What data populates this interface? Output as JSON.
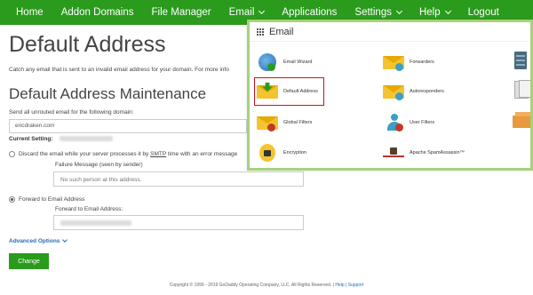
{
  "nav": {
    "items": [
      {
        "label": "Home",
        "dropdown": false
      },
      {
        "label": "Addon Domains",
        "dropdown": false
      },
      {
        "label": "File Manager",
        "dropdown": false
      },
      {
        "label": "Email",
        "dropdown": true
      },
      {
        "label": "Applications",
        "dropdown": false
      },
      {
        "label": "Settings",
        "dropdown": true
      },
      {
        "label": "Help",
        "dropdown": true
      },
      {
        "label": "Logout",
        "dropdown": false
      }
    ],
    "color": "#2b9b1d"
  },
  "page": {
    "title": "Default Address",
    "intro": "Catch any email that is sent to an invalid email address for your domain. For more info",
    "section_title": "Default Address Maintenance",
    "send_label": "Send all unrouted email for the following domain:",
    "domain_value": "ericdraken.com",
    "current_setting_label": "Current Setting:",
    "option_discard": {
      "label_before": "Discard the email while your server processes it by ",
      "label_smtp": "SMTP",
      "label_after": " time with an error message",
      "failure_label": "Failure Message (seen by sender)",
      "failure_placeholder": "No such person at this address.",
      "selected": false
    },
    "option_forward": {
      "label": "Forward to Email Address",
      "field_label": "Forward to Email Address:",
      "selected": true
    },
    "advanced_label": "Advanced Options",
    "change_button": "Change",
    "footer_text": "Copyright © 1999 - 2019 GoDaddy Operating Company, LLC. All Rights Reserved.",
    "footer_sep1": " | ",
    "footer_help": "Help",
    "footer_sep2": " | ",
    "footer_support": "Support"
  },
  "email_menu": {
    "title": "Email",
    "border_color": "#a7d17b",
    "highlight_color": "#d0121b",
    "items": [
      {
        "label": "Email Wizard",
        "icon": "email-wizard-icon"
      },
      {
        "label": "Forwarders",
        "icon": "forwarders-icon"
      },
      {
        "label": "Default Address",
        "icon": "default-address-icon",
        "highlighted": true
      },
      {
        "label": "Autoresponders",
        "icon": "autoresponders-icon"
      },
      {
        "label": "Global Filters",
        "icon": "global-filters-icon"
      },
      {
        "label": "User Filters",
        "icon": "user-filters-icon"
      },
      {
        "label": "Encryption",
        "icon": "encryption-icon"
      },
      {
        "label": "Apache SpamAssassin™",
        "icon": "spamassassin-icon"
      }
    ],
    "partial_icons": [
      "server-icon",
      "documents-icon",
      "archive-box-icon"
    ]
  }
}
